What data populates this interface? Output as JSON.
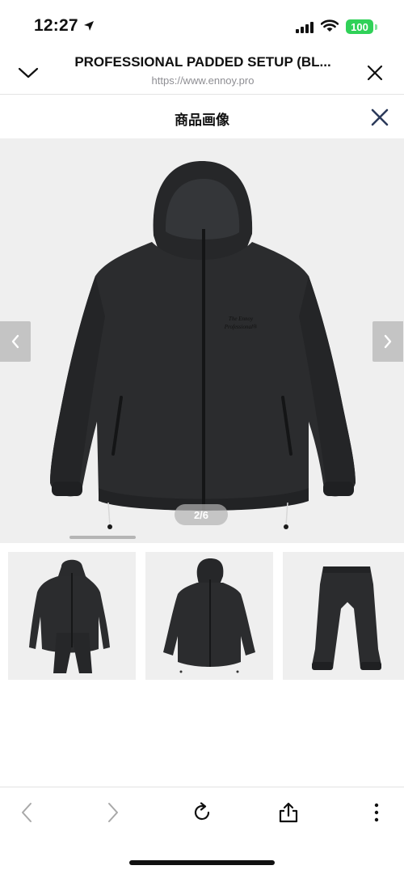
{
  "status_bar": {
    "time": "12:27",
    "battery": "100"
  },
  "browser": {
    "title": "PROFESSIONAL PADDED SETUP (BL...",
    "url": "https://www.ennoy.pro"
  },
  "gallery": {
    "title": "商品画像",
    "counter": "2/6",
    "jacket_print_line1": "The Ennoy",
    "jacket_print_line2": "Professional®",
    "current_index": 2,
    "total": 6,
    "thumbnails": [
      {
        "name": "setup-jacket-and-pants"
      },
      {
        "name": "jacket-front"
      },
      {
        "name": "pants"
      }
    ]
  },
  "icons": {
    "collapse": "chevron-down-icon",
    "close_tab": "close-icon",
    "gallery_close": "close-icon",
    "prev": "chevron-left-icon",
    "next": "chevron-right-icon",
    "back": "back-icon",
    "forward": "forward-icon",
    "reload": "reload-icon",
    "share": "share-icon",
    "more": "more-vertical-icon"
  },
  "colors": {
    "battery": "#30d158",
    "gallery_close": "#2c3a5a",
    "image_bg": "#efefef",
    "garment": "#2b2c2e"
  }
}
